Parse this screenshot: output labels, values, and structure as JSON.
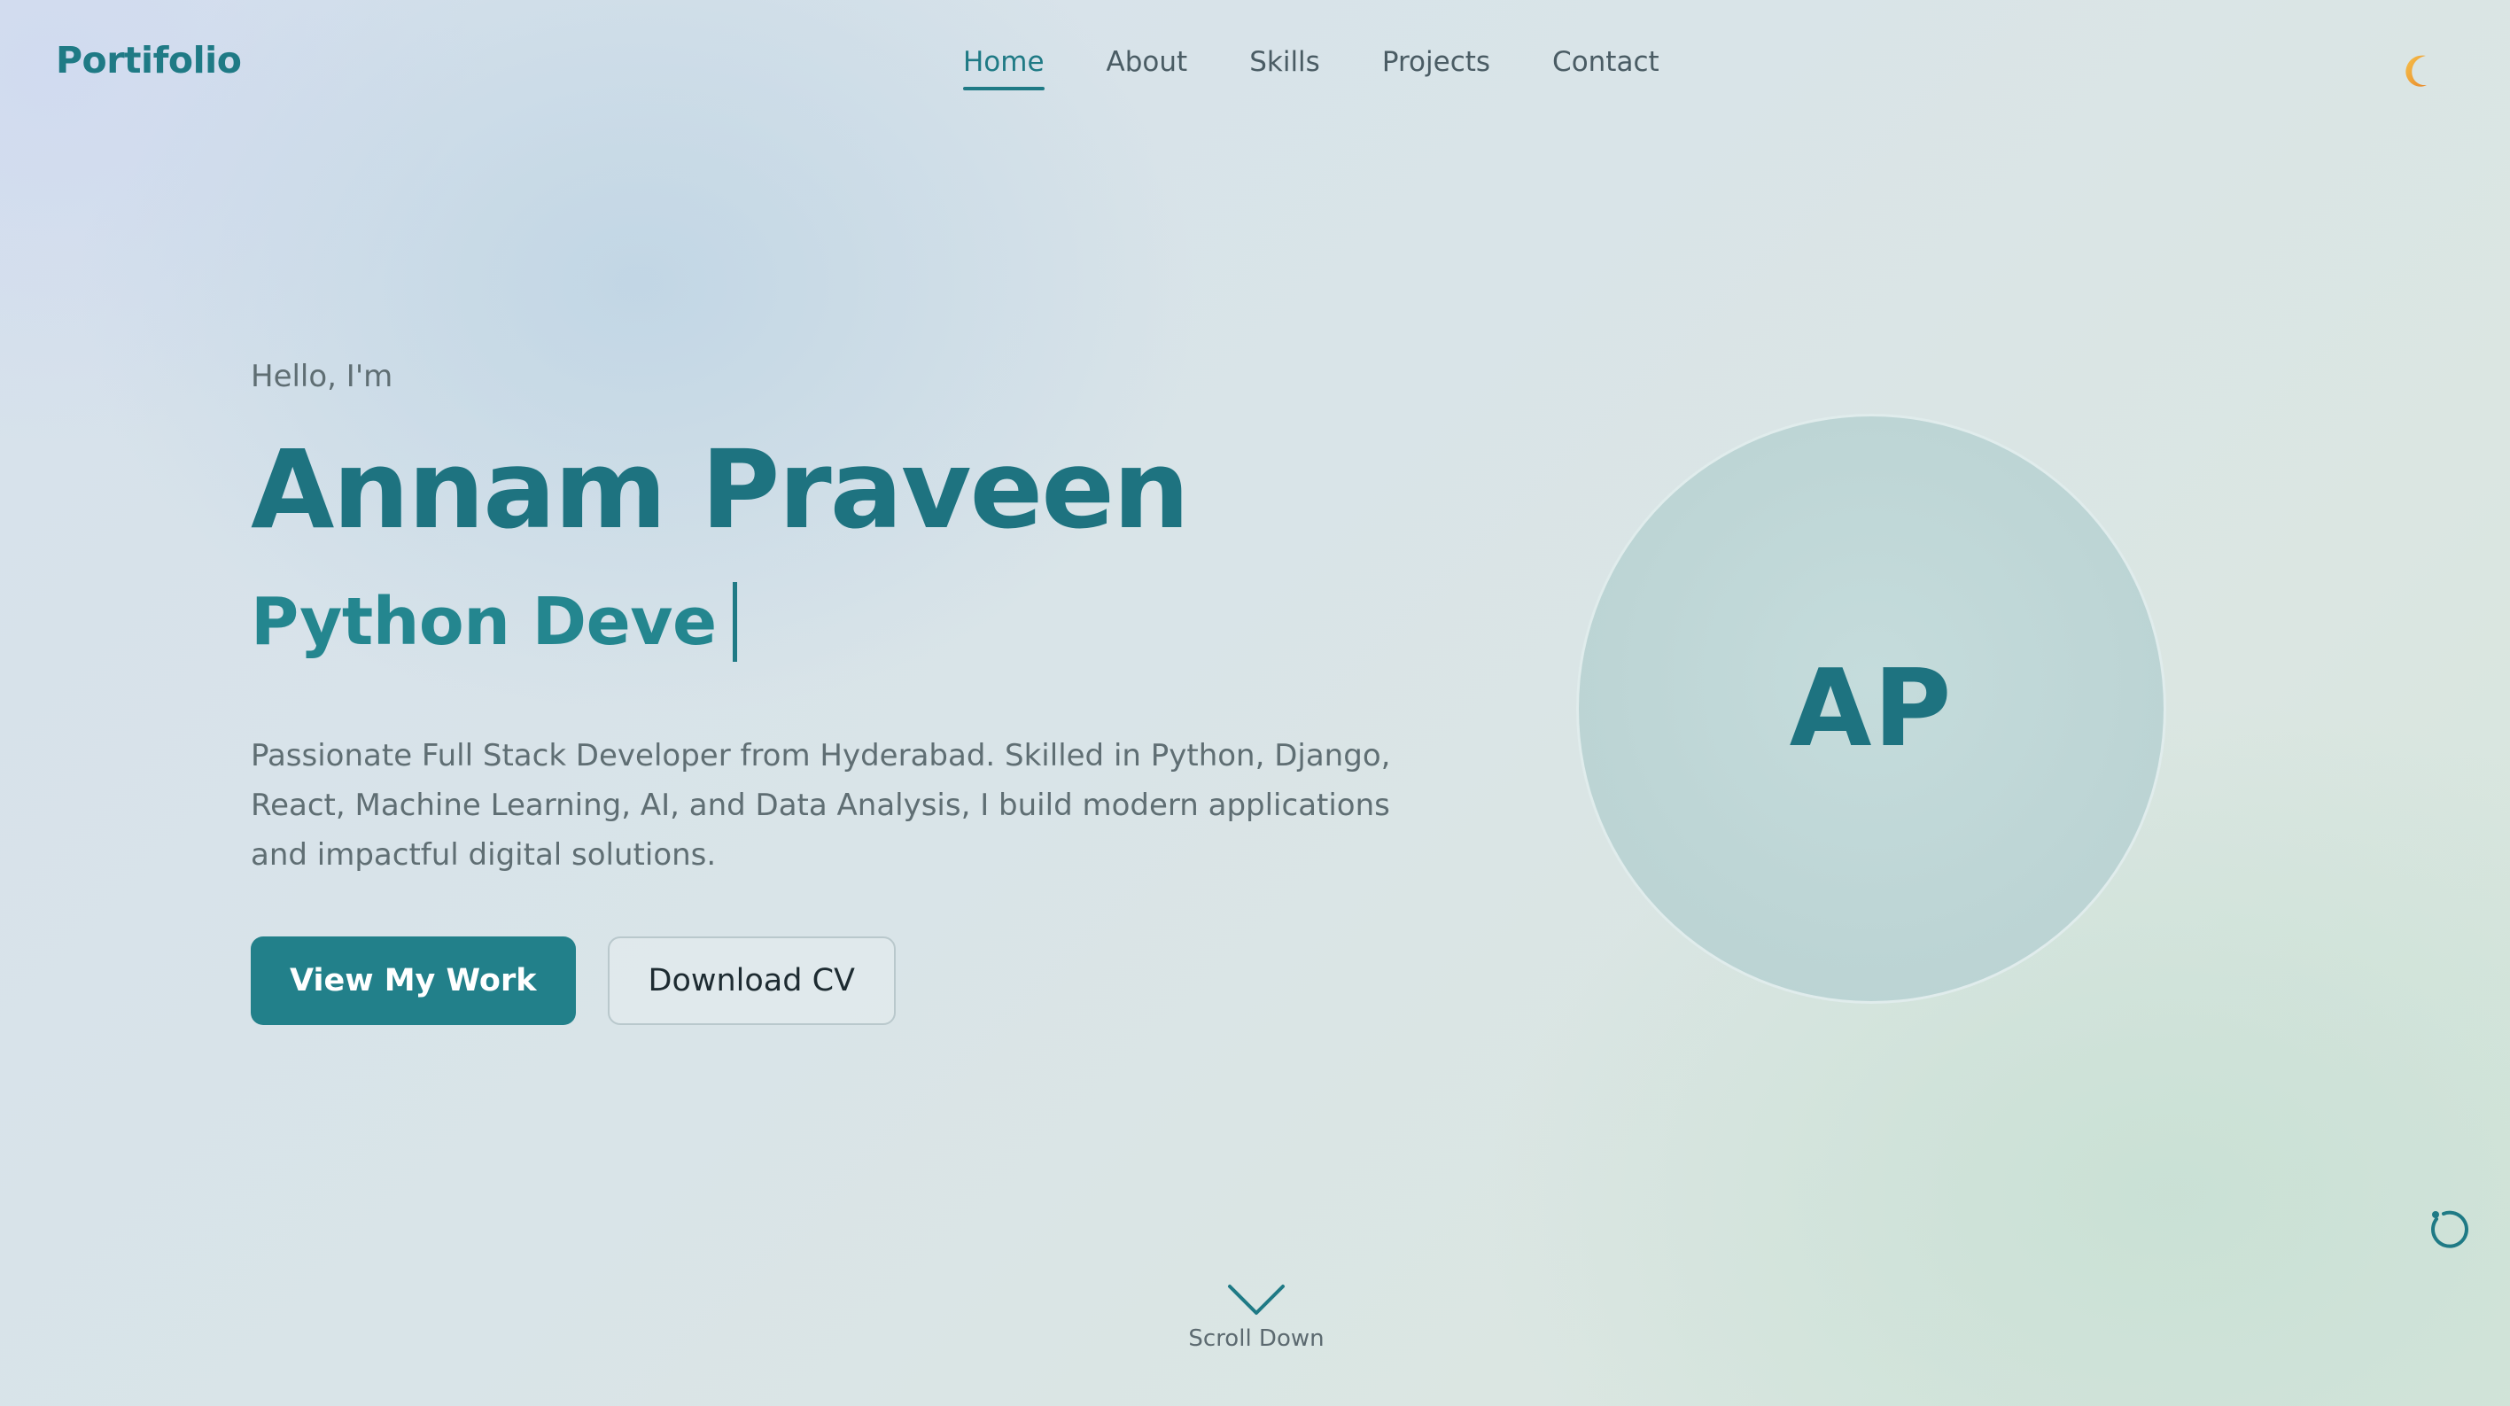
{
  "nav": {
    "brand": "Portifolio",
    "links": [
      {
        "label": "Home",
        "active": true
      },
      {
        "label": "About",
        "active": false
      },
      {
        "label": "Skills",
        "active": false
      },
      {
        "label": "Projects",
        "active": false
      },
      {
        "label": "Contact",
        "active": false
      }
    ],
    "theme_icon": "moon-icon"
  },
  "hero": {
    "greeting": "Hello, I'm",
    "name": "Annam Praveen",
    "role_typed": "Python Deve",
    "bio": "Passionate Full Stack Developer from Hyderabad. Skilled in Python, Django, React, Machine Learning, AI, and Data Analysis, I build modern applications and impactful digital solutions.",
    "primary_button": "View My Work",
    "secondary_button": "Download CV"
  },
  "avatar": {
    "initials": "AP"
  },
  "scroll": {
    "label": "Scroll Down",
    "icon": "chevron-down-icon"
  },
  "colors": {
    "accent": "#1f7a85",
    "button": "#22808a",
    "text_muted": "#5f6e73",
    "moon": "#f0a030"
  }
}
